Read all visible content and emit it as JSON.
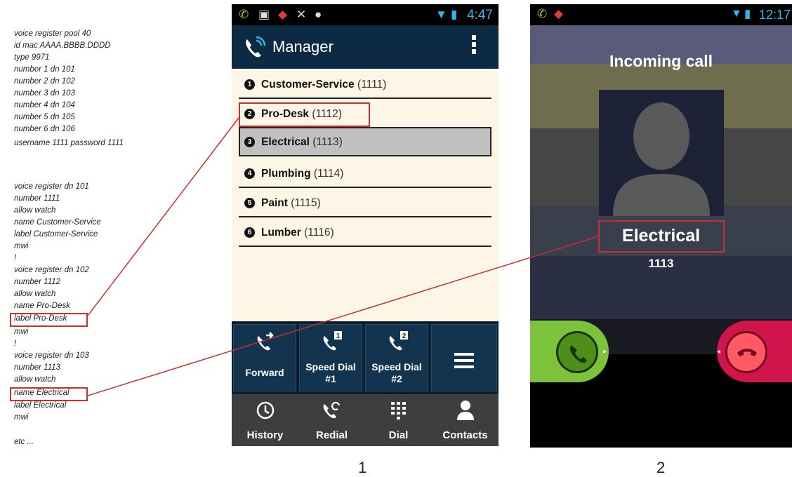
{
  "config_text": {
    "pool_block": [
      "voice register pool  40",
      " id mac AAAA.BBBB.DDDD",
      " type 9971",
      " number 1 dn 101",
      " number 2 dn 102",
      " number 3 dn 103",
      " number 4 dn 104",
      " number 5 dn 105",
      " number 6 dn 106",
      " username 1111 password 1111"
    ],
    "dn_block": [
      "voice register dn  101",
      "  number 1111",
      "  allow watch",
      "  name Customer-Service",
      "  label Customer-Service",
      "  mwi",
      " !",
      "voice register dn  102",
      "  number 1112",
      "  allow watch",
      "  name Pro-Desk",
      "  label Pro-Desk",
      "  mwi",
      " !",
      "voice register dn  103",
      "  number 1113",
      "  allow watch",
      "  name Electrical",
      "  label Electrical",
      "  mwi",
      "",
      "etc ..."
    ]
  },
  "phone1": {
    "status_time": "4:47",
    "app_title": "Manager",
    "lines": [
      {
        "num": "1",
        "name": "Customer-Service",
        "ext": " (1111)"
      },
      {
        "num": "2",
        "name": "Pro-Desk",
        "ext": " (1112)"
      },
      {
        "num": "3",
        "name": "Electrical",
        "ext": " (1113)"
      },
      {
        "num": "4",
        "name": "Plumbing",
        "ext": " (1114)"
      },
      {
        "num": "5",
        "name": "Paint",
        "ext": " (1115)"
      },
      {
        "num": "6",
        "name": "Lumber",
        "ext": " (1116)"
      }
    ],
    "actions": {
      "forward": "Forward",
      "speed1_line1": "Speed Dial",
      "speed1_line2": "#1",
      "speed2_line1": "Speed Dial",
      "speed2_line2": "#2"
    },
    "speed_badges": [
      "1",
      "2"
    ],
    "nav": {
      "history": "History",
      "redial": "Redial",
      "dial": "Dial",
      "contacts": "Contacts"
    }
  },
  "phone2": {
    "status_time": "12:17",
    "incoming_title": "Incoming call",
    "caller_name": "Electrical",
    "caller_number": "1113"
  },
  "figure_labels": {
    "phone1": "1",
    "phone2": "2"
  },
  "colors": {
    "highlight": "#c8302f",
    "actionbar": "#0d2a45",
    "accept": "#7cc23a",
    "decline": "#d0144c"
  }
}
